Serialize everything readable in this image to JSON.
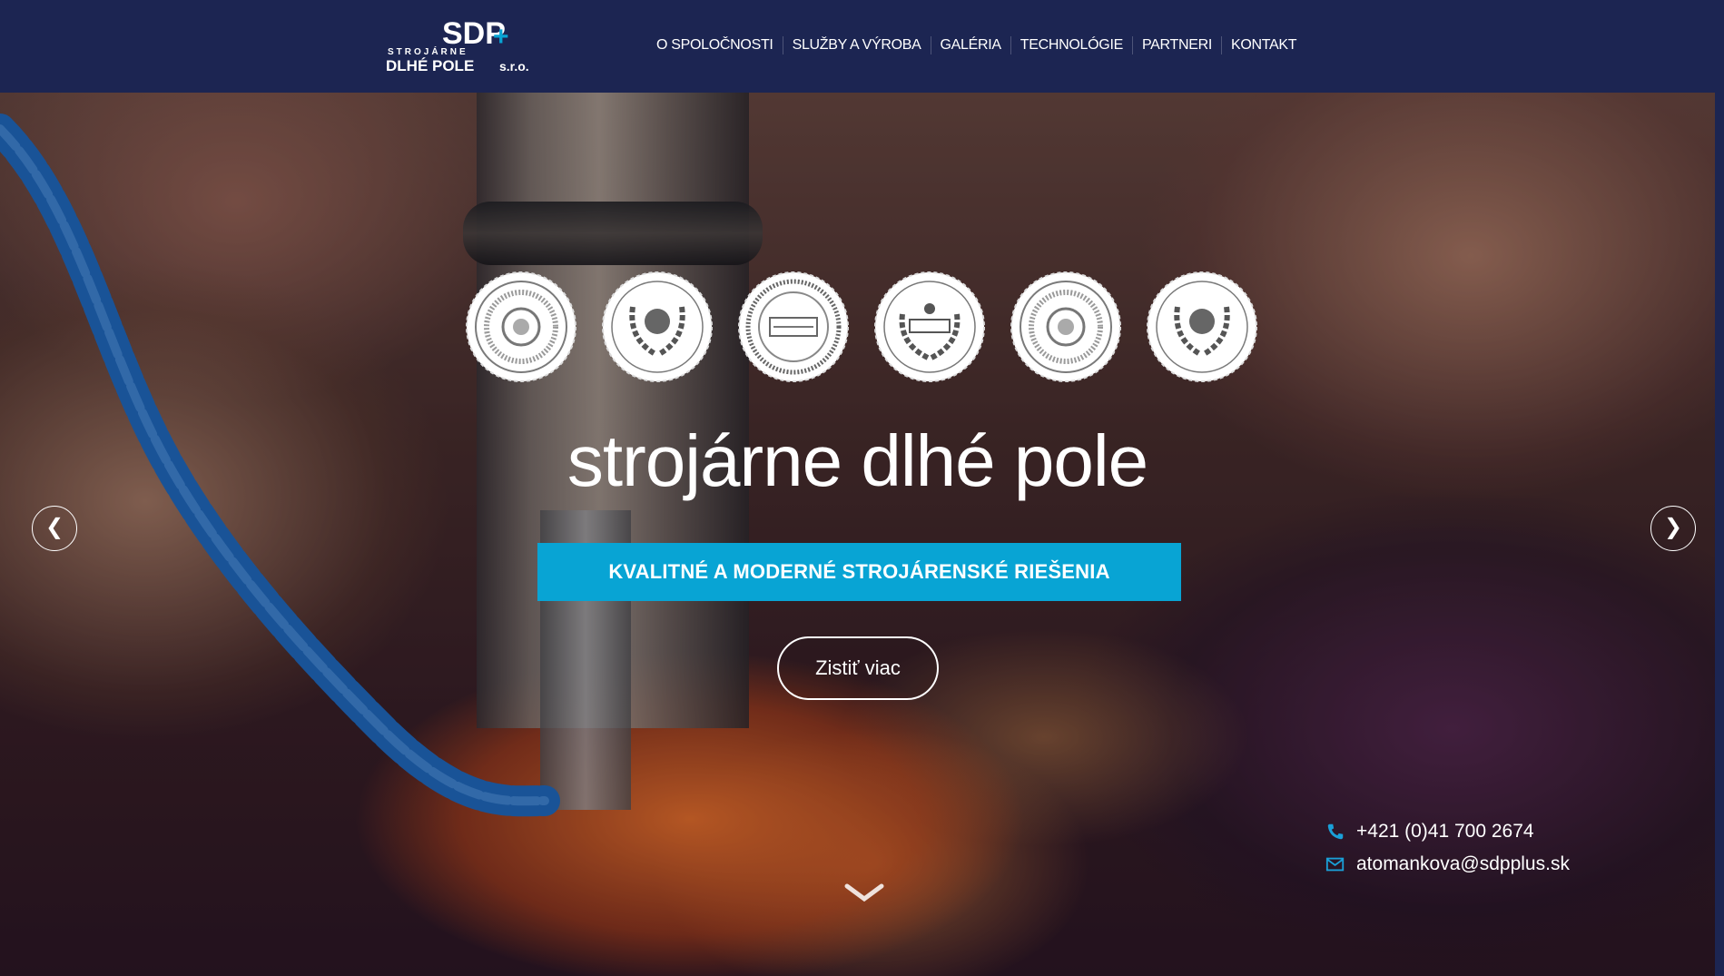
{
  "header": {
    "logo_top": "SDP",
    "logo_sub": "STROJÁRNE",
    "logo_name": "DLHÉ POLE",
    "logo_suffix": "s.r.o.",
    "nav": [
      {
        "label": "O SPOLOČNOSTI"
      },
      {
        "label": "SLUŽBY A VÝROBA"
      },
      {
        "label": "GALÉRIA"
      },
      {
        "label": "TECHNOLÓGIE"
      },
      {
        "label": "PARTNERI"
      },
      {
        "label": "KONTAKT"
      }
    ]
  },
  "hero": {
    "title": "strojárne dlhé pole",
    "tagline": "KVALITNÉ A MODERNÉ STROJÁRENSKÉ RIEŠENIA",
    "cta_label": "Zistiť viac",
    "prev_arrow": "❮",
    "next_arrow": "❯",
    "seals": [
      "seal-icon",
      "laurel-seal-icon",
      "banner-seal-icon",
      "crest-seal-icon",
      "seal-icon",
      "laurel-seal-icon"
    ]
  },
  "contact": {
    "phone": "+421 (0)41 700 2674",
    "email": "atomankova@sdpplus.sk"
  },
  "colors": {
    "header_bg": "#1c2552",
    "accent": "#08a4d4",
    "text": "#ffffff"
  }
}
